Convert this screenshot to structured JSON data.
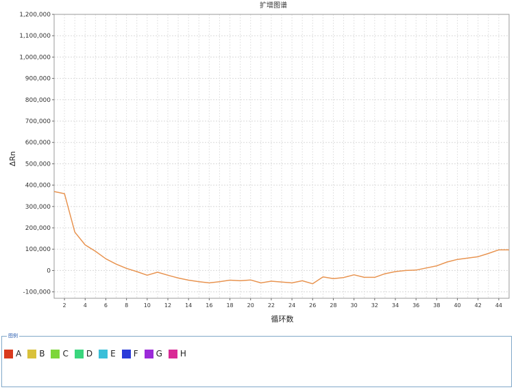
{
  "chart_data": {
    "type": "line",
    "title": "扩增图谱",
    "xlabel": "循环数",
    "ylabel": "ΔRn",
    "xlim": [
      1,
      45
    ],
    "ylim": [
      -130000,
      1200000
    ],
    "x_ticks": [
      2,
      4,
      6,
      8,
      10,
      12,
      14,
      16,
      18,
      20,
      22,
      24,
      26,
      28,
      30,
      32,
      34,
      36,
      38,
      40,
      42,
      44
    ],
    "y_ticks": [
      "-100,000",
      "0",
      "100,000",
      "200,000",
      "300,000",
      "400,000",
      "500,000",
      "600,000",
      "700,000",
      "800,000",
      "900,000",
      "1,000,000",
      "1,100,000",
      "1,200,000"
    ],
    "y_tick_values": [
      -100000,
      0,
      100000,
      200000,
      300000,
      400000,
      500000,
      600000,
      700000,
      800000,
      900000,
      1000000,
      1100000,
      1200000
    ],
    "grid": true,
    "series": [
      {
        "color": "#e8934f",
        "x": [
          1,
          2,
          3,
          4,
          5,
          6,
          7,
          8,
          9,
          10,
          11,
          12,
          13,
          14,
          15,
          16,
          17,
          18,
          19,
          20,
          21,
          22,
          23,
          24,
          25,
          26,
          27,
          28,
          29,
          30,
          31,
          32,
          33,
          34,
          35,
          36,
          37,
          38,
          39,
          40,
          41,
          42,
          43,
          44,
          45
        ],
        "values": [
          370000,
          360000,
          180000,
          120000,
          90000,
          55000,
          30000,
          10000,
          -5000,
          -22000,
          -8000,
          -22000,
          -35000,
          -45000,
          -52000,
          -58000,
          -52000,
          -45000,
          -48000,
          -44000,
          -58000,
          -50000,
          -54000,
          -58000,
          -48000,
          -62000,
          -30000,
          -38000,
          -33000,
          -20000,
          -32000,
          -32000,
          -15000,
          -5000,
          0,
          2000,
          12000,
          22000,
          40000,
          52000,
          58000,
          65000,
          80000,
          97000,
          97000
        ]
      }
    ]
  },
  "legend": {
    "title": "图例",
    "items": [
      {
        "label": "A",
        "color": "#d93a1e"
      },
      {
        "label": "B",
        "color": "#d9c13a"
      },
      {
        "label": "C",
        "color": "#7dd63a"
      },
      {
        "label": "D",
        "color": "#3ad67d"
      },
      {
        "label": "E",
        "color": "#3abfd9"
      },
      {
        "label": "F",
        "color": "#2a3ad9"
      },
      {
        "label": "G",
        "color": "#9b2ad9"
      },
      {
        "label": "H",
        "color": "#d92a96"
      }
    ]
  }
}
